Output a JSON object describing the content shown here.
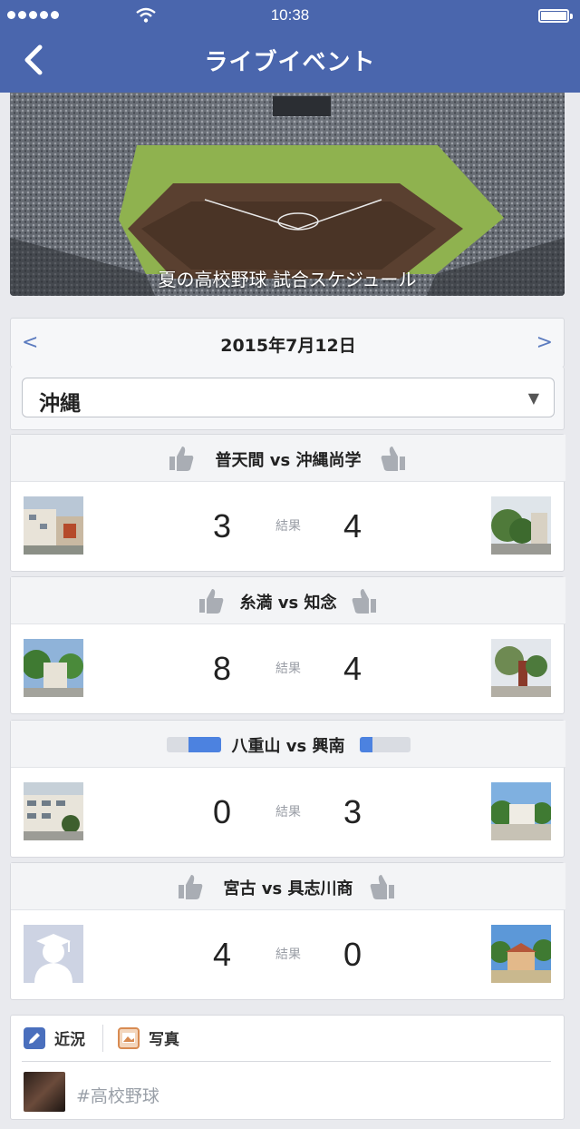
{
  "status": {
    "time": "10:38"
  },
  "nav": {
    "title": "ライブイベント",
    "back_icon": "chevron-left-icon"
  },
  "hero": {
    "caption": "夏の高校野球 試合スケジュール"
  },
  "schedule": {
    "date": "2015年7月12日",
    "prev_label": "<",
    "next_label": ">",
    "region": "沖縄",
    "matches": [
      {
        "title": "普天間 vs 沖縄尚学",
        "score_home": "3",
        "score_away": "4",
        "result_label": "結果",
        "header_style": "thumbs"
      },
      {
        "title": "糸満 vs 知念",
        "score_home": "8",
        "score_away": "4",
        "result_label": "結果",
        "header_style": "thumbs"
      },
      {
        "title": "八重山 vs 興南",
        "score_home": "0",
        "score_away": "3",
        "result_label": "結果",
        "header_style": "bars",
        "bar_left_fill": 0.6,
        "bar_right_fill": 0.25
      },
      {
        "title": "宮古 vs 具志川商",
        "score_home": "4",
        "score_away": "0",
        "result_label": "結果",
        "header_style": "thumbs"
      }
    ]
  },
  "composer": {
    "status_tab": "近況",
    "photo_tab": "写真",
    "hashtag": "#高校野球"
  },
  "colors": {
    "nav_bg": "#4a66ad",
    "accent": "#4c82e0"
  }
}
